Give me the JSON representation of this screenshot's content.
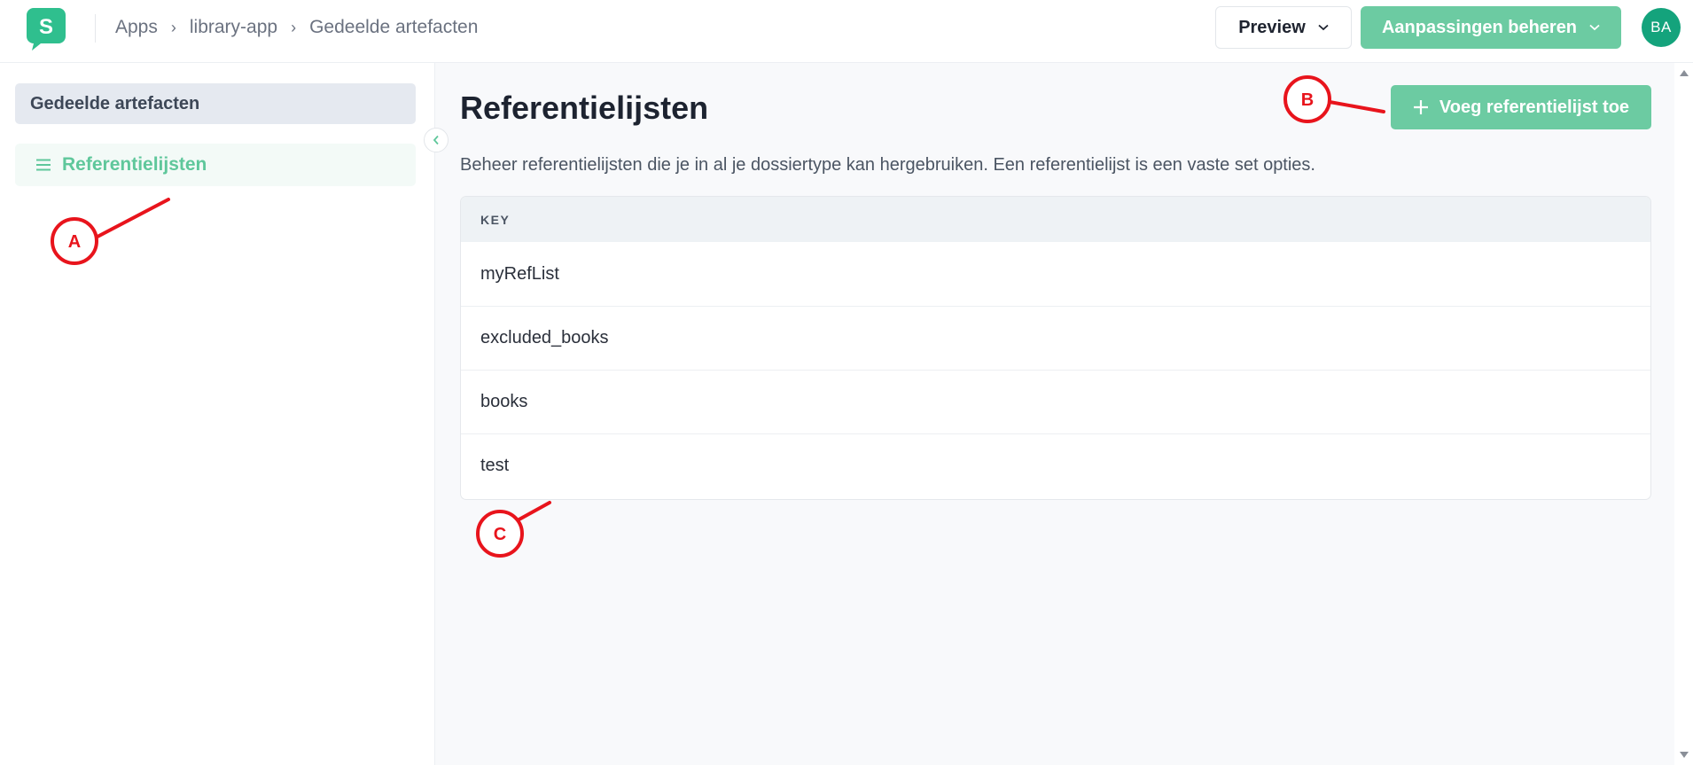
{
  "header": {
    "logo_letter": "S",
    "breadcrumb": [
      "Apps",
      "library-app",
      "Gedeelde artefacten"
    ],
    "breadcrumb_separator": "›",
    "preview_label": "Preview",
    "manage_changes_label": "Aanpassingen beheren",
    "avatar_initials": "BA"
  },
  "sidebar": {
    "heading": "Gedeelde artefacten",
    "items": [
      {
        "label": "Referentielijsten",
        "icon": "menu-lines-icon",
        "active": true
      }
    ]
  },
  "main": {
    "title": "Referentielijsten",
    "add_button_label": "Voeg referentielijst toe",
    "description": "Beheer referentielijsten die je in al je dossiertype kan hergebruiken. Een referentielijst is een vaste set opties.",
    "table": {
      "columns": [
        "KEY"
      ],
      "rows": [
        "myRefList",
        "excluded_books",
        "books",
        "test"
      ]
    }
  },
  "annotations": [
    "A",
    "B",
    "C"
  ],
  "colors": {
    "accent": "#6ccba2",
    "accent_text": "#5fc79b",
    "avatar": "#14a37c",
    "logo": "#2fbf8e",
    "annotation": "#e8141c"
  }
}
